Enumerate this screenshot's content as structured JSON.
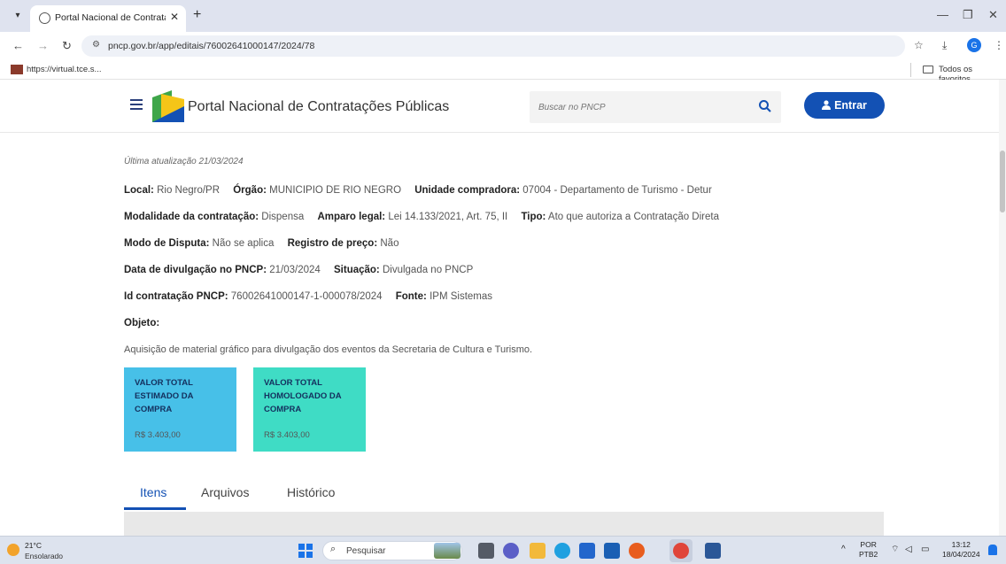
{
  "browser": {
    "tab_title": "Portal Nacional de Contrataçõ",
    "new_tab": "+",
    "tab_close": "✕",
    "url": "pncp.gov.br/app/editais/76002641000147/2024/78",
    "bookmark": "https://virtual.tce.s...",
    "bookmarks_folder": "Todos os favoritos",
    "profile_initial": "G"
  },
  "header": {
    "site_title": "Portal Nacional de Contratações Públicas",
    "search_placeholder": "Buscar no PNCP",
    "login_label": "Entrar"
  },
  "edital": {
    "last_update": "Última atualização 21/03/2024",
    "fields": [
      {
        "label": "Local:",
        "value": "Rio Negro/PR"
      },
      {
        "label": "Órgão:",
        "value": "MUNICIPIO DE RIO NEGRO"
      },
      {
        "label": "Unidade compradora:",
        "value": "07004 - Departamento de Turismo - Detur"
      },
      {
        "label": "Modalidade da contratação:",
        "value": "Dispensa"
      },
      {
        "label": "Amparo legal:",
        "value": "Lei 14.133/2021, Art. 75, II"
      },
      {
        "label": "Tipo:",
        "value": "Ato que autoriza a Contratação Direta"
      },
      {
        "label": "Modo de Disputa:",
        "value": "Não se aplica"
      },
      {
        "label": "Registro de preço:",
        "value": "Não"
      },
      {
        "label": "Data de divulgação no PNCP:",
        "value": "21/03/2024"
      },
      {
        "label": "Situação:",
        "value": "Divulgada no PNCP"
      },
      {
        "label": "Id contratação PNCP:",
        "value": "76002641000147-1-000078/2024"
      },
      {
        "label": "Fonte:",
        "value": "IPM Sistemas"
      }
    ],
    "objeto_label": "Objeto:",
    "objeto_text": "Aquisição de material gráfico para divulgação dos eventos da Secretaria de Cultura e Turismo.",
    "cards": [
      {
        "label": "VALOR TOTAL ESTIMADO DA COMPRA",
        "value": "R$ 3.403,00",
        "color": "#47c0e8"
      },
      {
        "label": "VALOR TOTAL HOMOLOGADO DA COMPRA",
        "value": "R$ 3.403,00",
        "color": "#3fdcc5"
      }
    ],
    "tabs": [
      "Itens",
      "Arquivos",
      "Histórico"
    ]
  },
  "taskbar": {
    "temperature": "21°C",
    "weather": "Ensolarado",
    "search_label": "Pesquisar",
    "lang": "POR",
    "layout": "PTB2",
    "time": "13:12",
    "date": "18/04/2024"
  },
  "colors": {
    "primary": "#1351b4",
    "card_blue": "#47c0e8",
    "card_teal": "#3fdcc5"
  }
}
